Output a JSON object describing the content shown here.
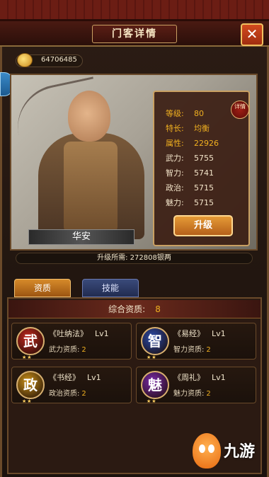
{
  "title": "门客详情",
  "close_label": "✕",
  "currency": {
    "icon": "gold-coin-icon",
    "value": "64706485"
  },
  "retainer": {
    "name": "华安",
    "detail_badge": "详情",
    "stats": [
      {
        "label": "等级:",
        "value": "80",
        "highlight": true
      },
      {
        "label": "特长:",
        "value": "均衡",
        "highlight": true
      },
      {
        "label": "属性:",
        "value": "22926",
        "highlight": true
      },
      {
        "label": "武力:",
        "value": "5755",
        "highlight": false
      },
      {
        "label": "智力:",
        "value": "5741",
        "highlight": false
      },
      {
        "label": "政治:",
        "value": "5715",
        "highlight": false
      },
      {
        "label": "魅力:",
        "value": "5715",
        "highlight": false
      }
    ],
    "upgrade_label": "升级",
    "upgrade_requirement": "升级所需: 272808银两"
  },
  "tabs": [
    {
      "label": "资质",
      "active": true
    },
    {
      "label": "技能",
      "active": false
    }
  ],
  "summary": {
    "label": "综合资质:",
    "value": "8"
  },
  "books": [
    {
      "glyph": "武",
      "color": "#c0281c",
      "title": "《吐纳法》",
      "level": "Lv1",
      "aptitude_label": "武力资质:",
      "aptitude_value": "2",
      "stars": "★★"
    },
    {
      "glyph": "智",
      "color": "#2a4aa8",
      "title": "《易经》",
      "level": "Lv1",
      "aptitude_label": "智力资质:",
      "aptitude_value": "2",
      "stars": "★★"
    },
    {
      "glyph": "政",
      "color": "#c99018",
      "title": "《书经》",
      "level": "Lv1",
      "aptitude_label": "政治资质:",
      "aptitude_value": "2",
      "stars": "★★"
    },
    {
      "glyph": "魅",
      "color": "#7a2aa8",
      "title": "《周礼》",
      "level": "Lv1",
      "aptitude_label": "魅力资质:",
      "aptitude_value": "2",
      "stars": "★★"
    }
  ],
  "watermark": {
    "text": "九游"
  }
}
